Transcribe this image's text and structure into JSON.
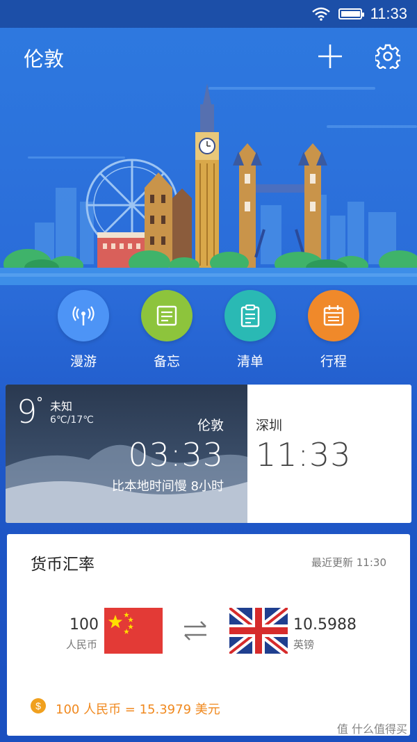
{
  "status_bar": {
    "time": "11:33"
  },
  "header": {
    "title": "伦敦"
  },
  "actions": [
    {
      "label": "漫游",
      "icon": "signal-antenna-icon",
      "color": "#4d94f6"
    },
    {
      "label": "备忘",
      "icon": "memo-icon",
      "color": "#8dc43c"
    },
    {
      "label": "清单",
      "icon": "clipboard-list-icon",
      "color": "#2ab9b4"
    },
    {
      "label": "行程",
      "icon": "calendar-icon",
      "color": "#f0892a"
    }
  ],
  "time_card": {
    "temperature": "9",
    "temp_unit": "°",
    "condition": "未知",
    "temp_range": "6℃/17℃",
    "destination_city": "伦敦",
    "destination_time": "03:33",
    "time_difference": "比本地时间慢 8小时",
    "local_city": "深圳",
    "local_time": "11:33"
  },
  "currency": {
    "title": "货币汇率",
    "updated": "最近更新 11:30",
    "from_amount": "100",
    "from_currency": "人民币",
    "to_amount": "10.5988",
    "to_currency": "英镑",
    "note": "100 人民币 = 15.3979 美元"
  },
  "watermark": "值 什么值得买",
  "colors": {
    "accent": "#2a6bd8",
    "note": "#f0891f"
  }
}
